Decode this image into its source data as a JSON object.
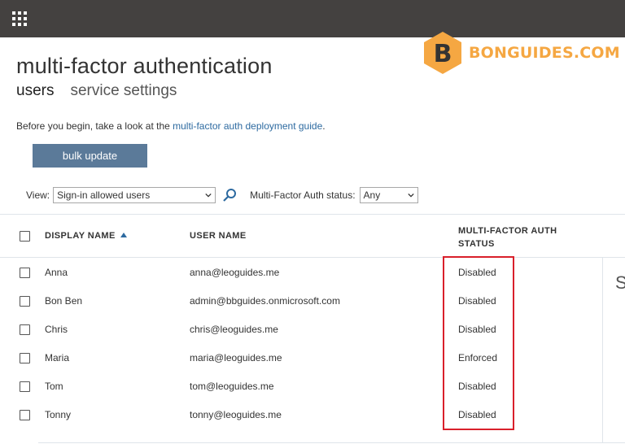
{
  "brand": {
    "logo_letter": "B",
    "logo_text": "BONGUIDES.COM",
    "logo_color": "#f5a742"
  },
  "page": {
    "title": "multi-factor authentication",
    "tabs": [
      {
        "label": "users",
        "active": true
      },
      {
        "label": "service settings",
        "active": false
      }
    ]
  },
  "intro": {
    "prefix": "Before you begin, take a look at the ",
    "link": "multi-factor auth deployment guide",
    "suffix": "."
  },
  "actions": {
    "bulk_update": "bulk update"
  },
  "filters": {
    "view_label": "View:",
    "view_value": "Sign-in allowed users",
    "status_label": "Multi-Factor Auth status:",
    "status_value": "Any"
  },
  "table": {
    "columns": {
      "display_name": "DISPLAY NAME",
      "user_name": "USER NAME",
      "mfa_status_line1": "MULTI-FACTOR AUTH",
      "mfa_status_line2": "STATUS"
    },
    "sort_indicator": "ascending",
    "rows": [
      {
        "display_name": "Anna",
        "user_name": "anna@leoguides.me",
        "status": "Disabled"
      },
      {
        "display_name": "Bon Ben",
        "user_name": "admin@bbguides.onmicrosoft.com",
        "status": "Disabled"
      },
      {
        "display_name": "Chris",
        "user_name": "chris@leoguides.me",
        "status": "Disabled"
      },
      {
        "display_name": "Maria",
        "user_name": "maria@leoguides.me",
        "status": "Enforced"
      },
      {
        "display_name": "Tom",
        "user_name": "tom@leoguides.me",
        "status": "Disabled"
      },
      {
        "display_name": "Tonny",
        "user_name": "tonny@leoguides.me",
        "status": "Disabled"
      }
    ]
  },
  "side_panel": {
    "partial_text": "S"
  },
  "colors": {
    "topbar": "#444140",
    "button": "#5b7a99",
    "link": "#2d6aa0",
    "highlight": "#d9202b"
  }
}
